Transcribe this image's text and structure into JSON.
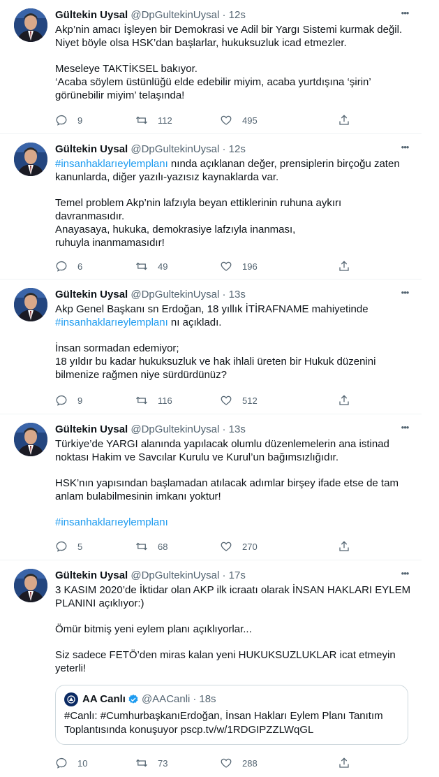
{
  "tweets": [
    {
      "name": "Gültekin Uysal",
      "handle": "@DpGultekinUysal",
      "separator": "·",
      "time": "12s",
      "lines": [
        "Akp’nin amacı İşleyen bir Demokrasi ve Adil bir Yargı Sistemi kurmak değil.",
        "Niyet böyle olsa HSK’dan başlarlar, hukuksuzluk icad etmezler.",
        "",
        "Meseleye TAKTİKSEL bakıyor.",
        "‘Acaba söylem üstünlüğü elde edebilir miyim, acaba yurtdışına ‘şirin’",
        "görünebilir miyim’ telaşında!"
      ],
      "replies": "9",
      "retweets": "112",
      "likes": "495"
    },
    {
      "name": "Gültekin Uysal",
      "handle": "@DpGultekinUysal",
      "separator": "·",
      "time": "12s",
      "line1_hashtag": "#insanhaklarıeylemplanı",
      "line1_rest": " nında açıklanan değer, prensiplerin birçoğu zaten",
      "lines": [
        "kanunlarda, diğer yazılı-yazısız kaynaklarda var.",
        "",
        "Temel problem Akp’nin lafzıyla beyan ettiklerinin ruhuna aykırı",
        "davranmasıdır.",
        "Anayasaya, hukuka, demokrasiye lafzıyla inanması,",
        "ruhuyla inanmamasıdır!"
      ],
      "replies": "6",
      "retweets": "49",
      "likes": "196"
    },
    {
      "name": "Gültekin Uysal",
      "handle": "@DpGultekinUysal",
      "separator": "·",
      "time": "13s",
      "line1": "Akp Genel Başkanı sn Erdoğan, 18 yıllık İTİRAFNAME mahiyetinde",
      "line2_hashtag": "#insanhaklarıeylemplanı",
      "line2_rest": " nı açıkladı.",
      "lines": [
        "",
        "İnsan sormadan edemiyor;",
        "18 yıldır bu kadar hukuksuzluk ve hak ihlali üreten bir Hukuk düzenini",
        "bilmenize rağmen niye sürdürdünüz?"
      ],
      "replies": "9",
      "retweets": "116",
      "likes": "512"
    },
    {
      "name": "Gültekin Uysal",
      "handle": "@DpGultekinUysal",
      "separator": "·",
      "time": "13s",
      "lines": [
        "Türkiye’de YARGI alanında yapılacak olumlu düzenlemelerin ana istinad",
        "noktası Hakim ve Savcılar Kurulu ve Kurul’un bağımsızlığıdır.",
        "",
        "HSK’nın yapısından başlamadan atılacak adımlar birşey ifade etse de tam",
        "anlam bulabilmesinin imkanı yoktur!",
        ""
      ],
      "hashtag_line": "#insanhaklarıeylemplanı",
      "replies": "5",
      "retweets": "68",
      "likes": "270"
    },
    {
      "name": "Gültekin Uysal",
      "handle": "@DpGultekinUysal",
      "separator": "·",
      "time": "17s",
      "lines": [
        "3 KASIM 2020’de İktidar olan AKP ilk icraatı olarak İNSAN HAKLARI EYLEM",
        "PLANINI açıklıyor:)",
        "",
        "Ömür bitmiş yeni eylem planı açıklıyorlar...",
        "",
        "Siz sadece FETÖ’den miras kalan yeni HUKUKSUZLUKLAR icat etmeyin",
        "yeterli!"
      ],
      "quote": {
        "name": "AA Canlı",
        "handle": "@AACanli",
        "separator": "·",
        "time": "18s",
        "line1": "#Canlı: #CumhurbaşkanıErdoğan, İnsan Hakları Eylem Planı Tanıtım",
        "line2": "Toplantısında konuşuyor pscp.tv/w/1RDGIPZZLWqGL"
      },
      "replies": "10",
      "retweets": "73",
      "likes": "288"
    }
  ],
  "icons": {
    "more": "more-icon",
    "reply": "reply-icon",
    "retweet": "retweet-icon",
    "like": "like-icon",
    "share": "share-icon",
    "verified": "verified-icon"
  },
  "colors": {
    "link": "#1d9bf0",
    "text": "#0f1419",
    "muted": "#536471",
    "border": "#eff3f4"
  }
}
